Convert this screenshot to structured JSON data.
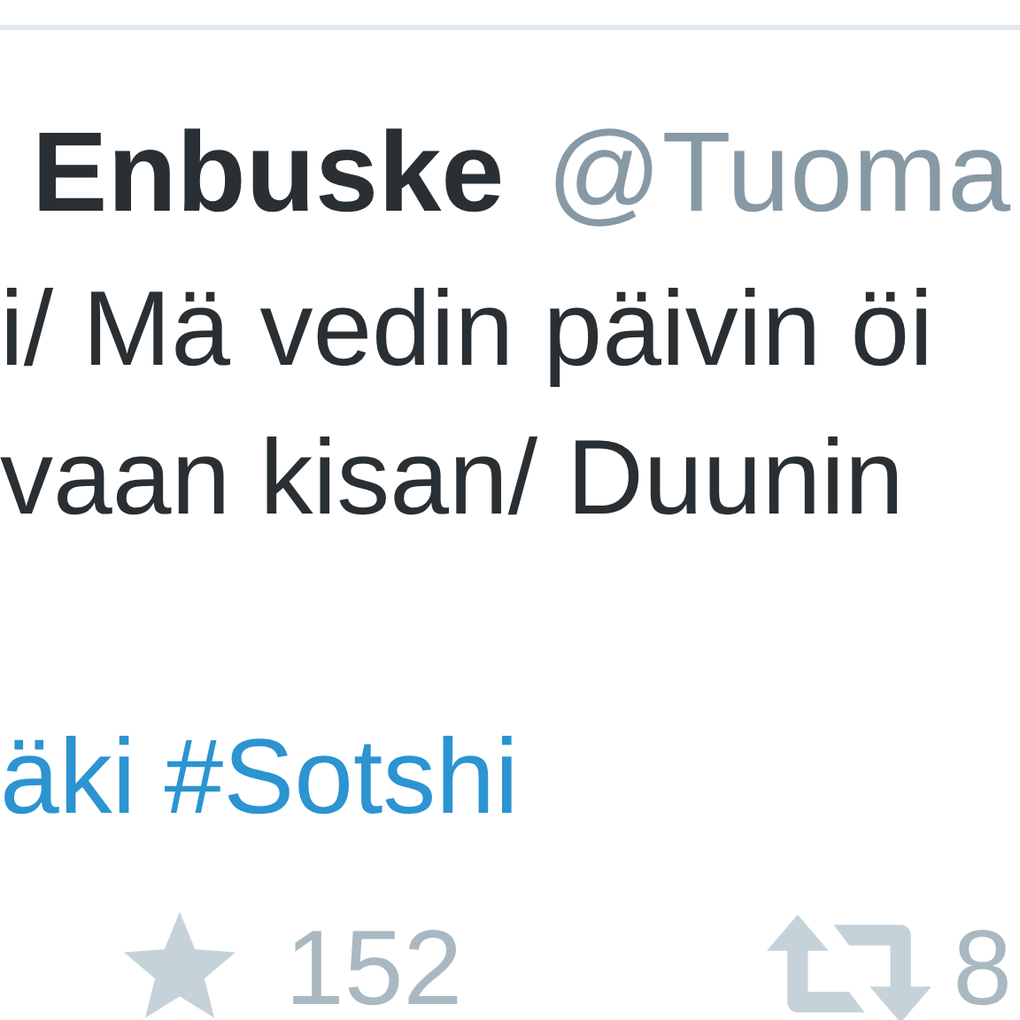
{
  "tweet": {
    "name": "Enbuske",
    "handle": "@Tuoma",
    "lines": [
      "i/ Mä vedin päivin öi",
      "vaan kisan/ Duunin"
    ],
    "hashtags": [
      "äki",
      "#Sotshi"
    ],
    "actions": [
      {
        "kind": "favorite",
        "count": "152"
      },
      {
        "kind": "retweet",
        "count": "8"
      }
    ]
  }
}
